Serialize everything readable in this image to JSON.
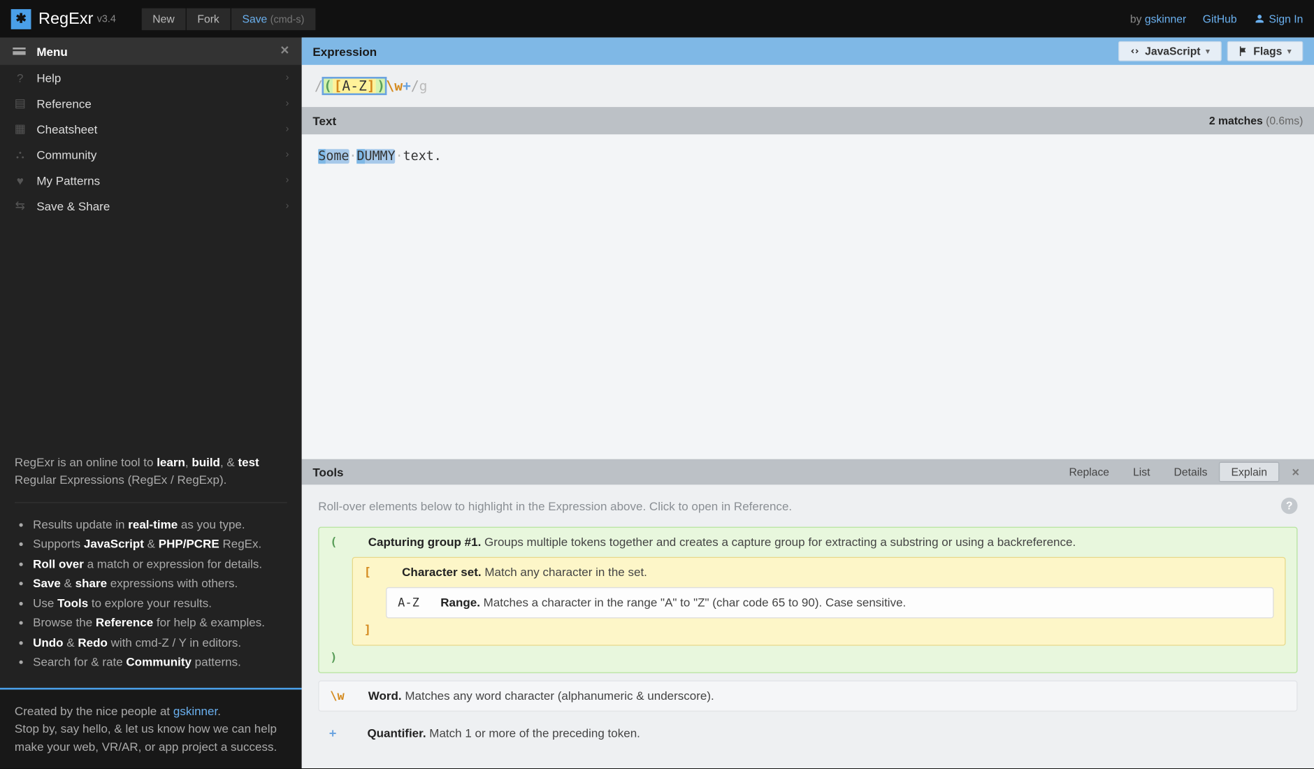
{
  "header": {
    "brand": "RegExr",
    "version": "v3.4",
    "new_label": "New",
    "fork_label": "Fork",
    "save_label": "Save",
    "save_hint": "(cmd-s)",
    "by_label": "by",
    "author": "gskinner",
    "github_label": "GitHub",
    "signin_label": "Sign In"
  },
  "sidebar": {
    "menu_title": "Menu",
    "items": [
      {
        "label": "Help",
        "icon": "help-circle-icon"
      },
      {
        "label": "Reference",
        "icon": "book-icon"
      },
      {
        "label": "Cheatsheet",
        "icon": "document-icon"
      },
      {
        "label": "Community",
        "icon": "people-icon"
      },
      {
        "label": "My Patterns",
        "icon": "heart-icon"
      },
      {
        "label": "Save & Share",
        "icon": "share-icon"
      }
    ],
    "about_intro_prefix": "RegExr is an online tool to ",
    "about_intro_learn": "learn",
    "about_intro_sep1": ", ",
    "about_intro_build": "build",
    "about_intro_sep2": ", & ",
    "about_intro_test": "test",
    "about_intro_suffix": " Regular Expressions (RegEx / RegExp).",
    "bullets": [
      {
        "pre": "Results update in ",
        "b": "real-time",
        "post": " as you type."
      },
      {
        "pre": "Supports ",
        "b": "JavaScript",
        "mid": " & ",
        "b2": "PHP/PCRE",
        "post": " RegEx."
      },
      {
        "pre": "",
        "b": "Roll over",
        "post": " a match or expression for details."
      },
      {
        "pre": "",
        "b": "Save",
        "mid": " & ",
        "b2": "share",
        "post": " expressions with others."
      },
      {
        "pre": "Use ",
        "b": "Tools",
        "post": " to explore your results."
      },
      {
        "pre": "Browse the ",
        "b": "Reference",
        "post": " for help & examples."
      },
      {
        "pre": "",
        "b": "Undo",
        "mid": " & ",
        "b2": "Redo",
        "post": " with cmd-Z / Y in editors."
      },
      {
        "pre": "Search for & rate ",
        "b": "Community",
        "post": " patterns."
      }
    ],
    "footer_created_prefix": "Created by the nice people at ",
    "footer_created_link": "gskinner",
    "footer_created_suffix": ".",
    "footer_line2": "Stop by, say hello, & let us know how we can help make your web, VR/AR, or app project a success."
  },
  "expression": {
    "title": "Expression",
    "flavor_label": "JavaScript",
    "flags_label": "Flags",
    "pattern_display": "([A-Z])\\w+",
    "flags": "g",
    "tokens": {
      "open_paren": "(",
      "open_bracket": "[",
      "range": "A-Z",
      "close_bracket": "]",
      "close_paren": ")",
      "word_class": "\\w",
      "quantifier": "+"
    }
  },
  "text": {
    "title": "Text",
    "matches_count": "2 matches",
    "matches_time": "(0.6ms)",
    "content": "Some DUMMY text.",
    "segments": {
      "m1_grp": "S",
      "m1_rest": "ome",
      "gap": " ",
      "m2_grp": "D",
      "m2_rest": "UMMY",
      "tail": " text."
    }
  },
  "tools": {
    "title": "Tools",
    "tabs": [
      "Replace",
      "List",
      "Details",
      "Explain"
    ],
    "active_tab": "Explain",
    "hint": "Roll-over elements below to highlight in the Expression above. Click to open in Reference.",
    "explain": {
      "group": {
        "token": "(",
        "close": ")",
        "title": "Capturing group #1.",
        "desc": "Groups multiple tokens together and creates a capture group for extracting a substring or using a backreference."
      },
      "charset": {
        "token": "[",
        "close": "]",
        "title": "Character set.",
        "desc": "Match any character in the set."
      },
      "range": {
        "token": "A-Z",
        "title": "Range.",
        "desc": "Matches a character in the range \"A\" to \"Z\" (char code 65 to 90). Case sensitive."
      },
      "word": {
        "token": "\\w",
        "title": "Word.",
        "desc": "Matches any word character (alphanumeric & underscore)."
      },
      "quant": {
        "token": "+",
        "title": "Quantifier.",
        "desc": "Match 1 or more of the preceding token."
      }
    }
  }
}
